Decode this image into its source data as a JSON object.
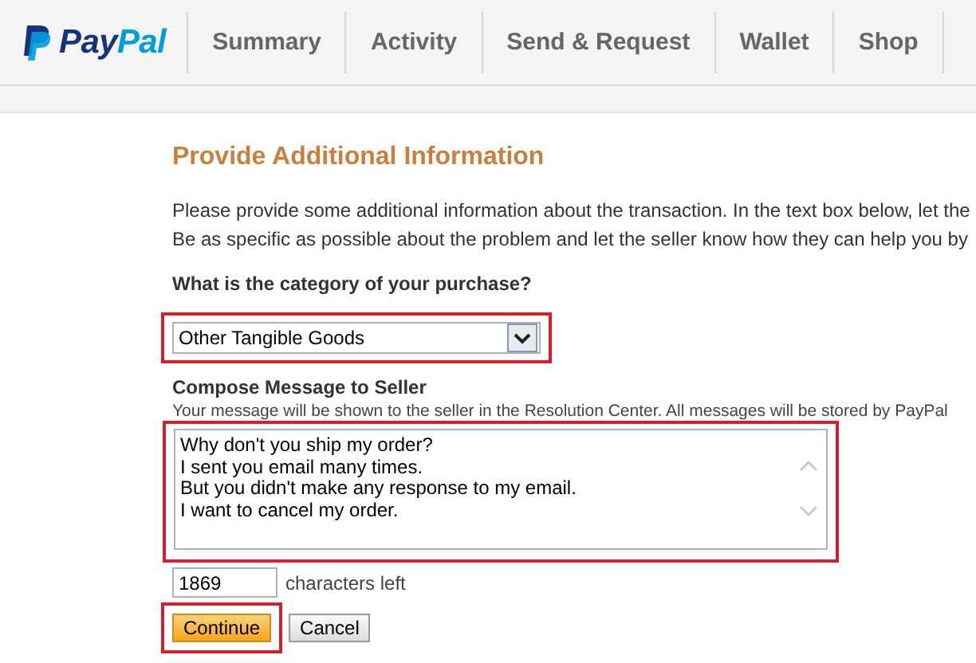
{
  "header": {
    "logo_parts": [
      "Pay",
      "Pal"
    ],
    "nav": [
      {
        "label": "Summary",
        "selected": false
      },
      {
        "label": "Activity",
        "selected": false
      },
      {
        "label": "Send & Request",
        "selected": false
      },
      {
        "label": "Wallet",
        "selected": false
      },
      {
        "label": "Shop",
        "selected": false
      }
    ]
  },
  "form": {
    "title": "Provide Additional Information",
    "intro_lines": [
      "Please provide some additional information about the transaction. In the text box below, let the",
      "Be as specific as possible about the problem and let the seller know how they can help you by"
    ],
    "category": {
      "label": "What is the category of your purchase?",
      "value": "Other Tangible Goods",
      "highlighted": true
    },
    "message": {
      "label": "Compose Message to Seller",
      "hint": "Your message will be shown to the seller in the Resolution Center. All messages will be stored by PayPal",
      "value": "Why don't you ship my order?\nI sent you email many times.\nBut you didn't make any response to my email.\nI want to cancel my order.",
      "highlighted": true
    },
    "counter": {
      "value": "1869",
      "label": "characters left"
    },
    "buttons": [
      {
        "kind": "primary",
        "label": "Continue",
        "highlighted": true
      },
      {
        "kind": "secondary",
        "label": "Cancel",
        "highlighted": false
      }
    ]
  }
}
